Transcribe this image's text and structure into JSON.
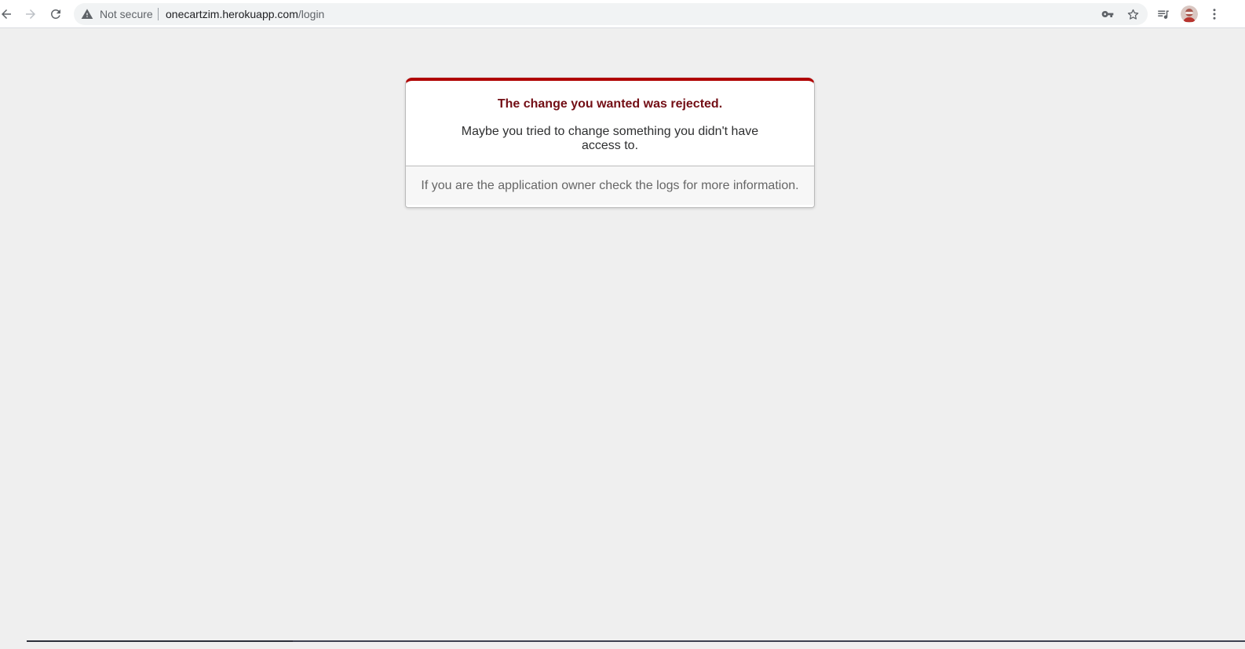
{
  "browser": {
    "security_label": "Not secure",
    "url_host": "onecartzim.herokuapp.com",
    "url_path": "/login",
    "icons": {
      "back": "back-arrow-icon",
      "forward": "forward-arrow-icon",
      "reload": "reload-icon",
      "warning": "warning-icon",
      "key": "key-icon",
      "star": "star-icon",
      "media": "media-queue-icon",
      "menu": "kebab-menu-icon"
    }
  },
  "error": {
    "title": "The change you wanted was rejected.",
    "message": "Maybe you tried to change something you didn't have access to.",
    "footer": "If you are the application owner check the logs for more information."
  },
  "colors": {
    "accent": "#b00100",
    "title": "#730e15",
    "page_bg": "#efefef"
  }
}
